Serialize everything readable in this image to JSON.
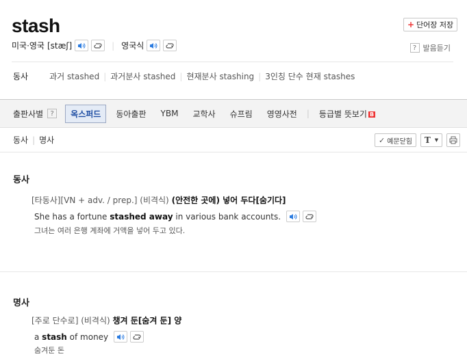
{
  "entry": {
    "word": "stash",
    "save_label": "단어장 저장",
    "pron_us_label": "미국·영국",
    "pron_us_ipa": "[stæʃ]",
    "pron_uk_label": "영국식",
    "listen_label": "발음듣기",
    "help_mark": "?"
  },
  "forms": {
    "pos": "동사",
    "items": [
      {
        "label": "과거",
        "value": "stashed"
      },
      {
        "label": "과거분사",
        "value": "stashed"
      },
      {
        "label": "현재분사",
        "value": "stashing"
      },
      {
        "label": "3인칭 단수 현재",
        "value": "stashes"
      }
    ]
  },
  "publisher_bar": {
    "label": "출판사별",
    "help_mark": "?",
    "tabs": [
      {
        "label": "옥스퍼드",
        "active": true
      },
      {
        "label": "동아출판",
        "active": false
      },
      {
        "label": "YBM",
        "active": false
      },
      {
        "label": "교학사",
        "active": false
      },
      {
        "label": "슈프림",
        "active": false
      },
      {
        "label": "영영사전",
        "active": false
      }
    ],
    "level_label": "등급별 뜻보기",
    "level_badge": "B"
  },
  "sub_bar": {
    "pos1": "동사",
    "pos2": "명사",
    "fold_examples": "예문닫힘",
    "font_button": "T"
  },
  "verb": {
    "title": "동사",
    "tags": "[타동사][VN + adv. / prep.] (비격식)",
    "meaning": "(안전한 곳에) 넣어 두다[숨기다]",
    "example_pre": "She has a fortune ",
    "example_bold": "stashed away",
    "example_post": " in various bank accounts.",
    "translation": "그녀는 여러 은행 계좌에 거액을 넣어 두고 있다."
  },
  "noun": {
    "title": "명사",
    "tags": "[주로 단수로] (비격식)",
    "meaning": "챙겨 둔[숨겨 둔] 양",
    "example_pre": "a ",
    "example_bold": "stash",
    "example_post": " of money",
    "translation": "숨겨둔 돈"
  },
  "colors": {
    "accent_blue": "#1f4ea3",
    "speaker_blue": "#2a7be0",
    "badge_red": "#e33333"
  }
}
